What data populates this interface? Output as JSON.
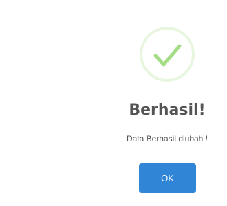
{
  "dialog": {
    "icon": "success-checkmark-icon",
    "title": "Berhasil!",
    "message": "Data Berhasil diubah !",
    "ok_label": "OK"
  },
  "colors": {
    "success": "#a5dc86",
    "success_ring": "#e8f6df",
    "text": "#545454",
    "button": "#3085d6",
    "button_text": "#ffffff"
  }
}
